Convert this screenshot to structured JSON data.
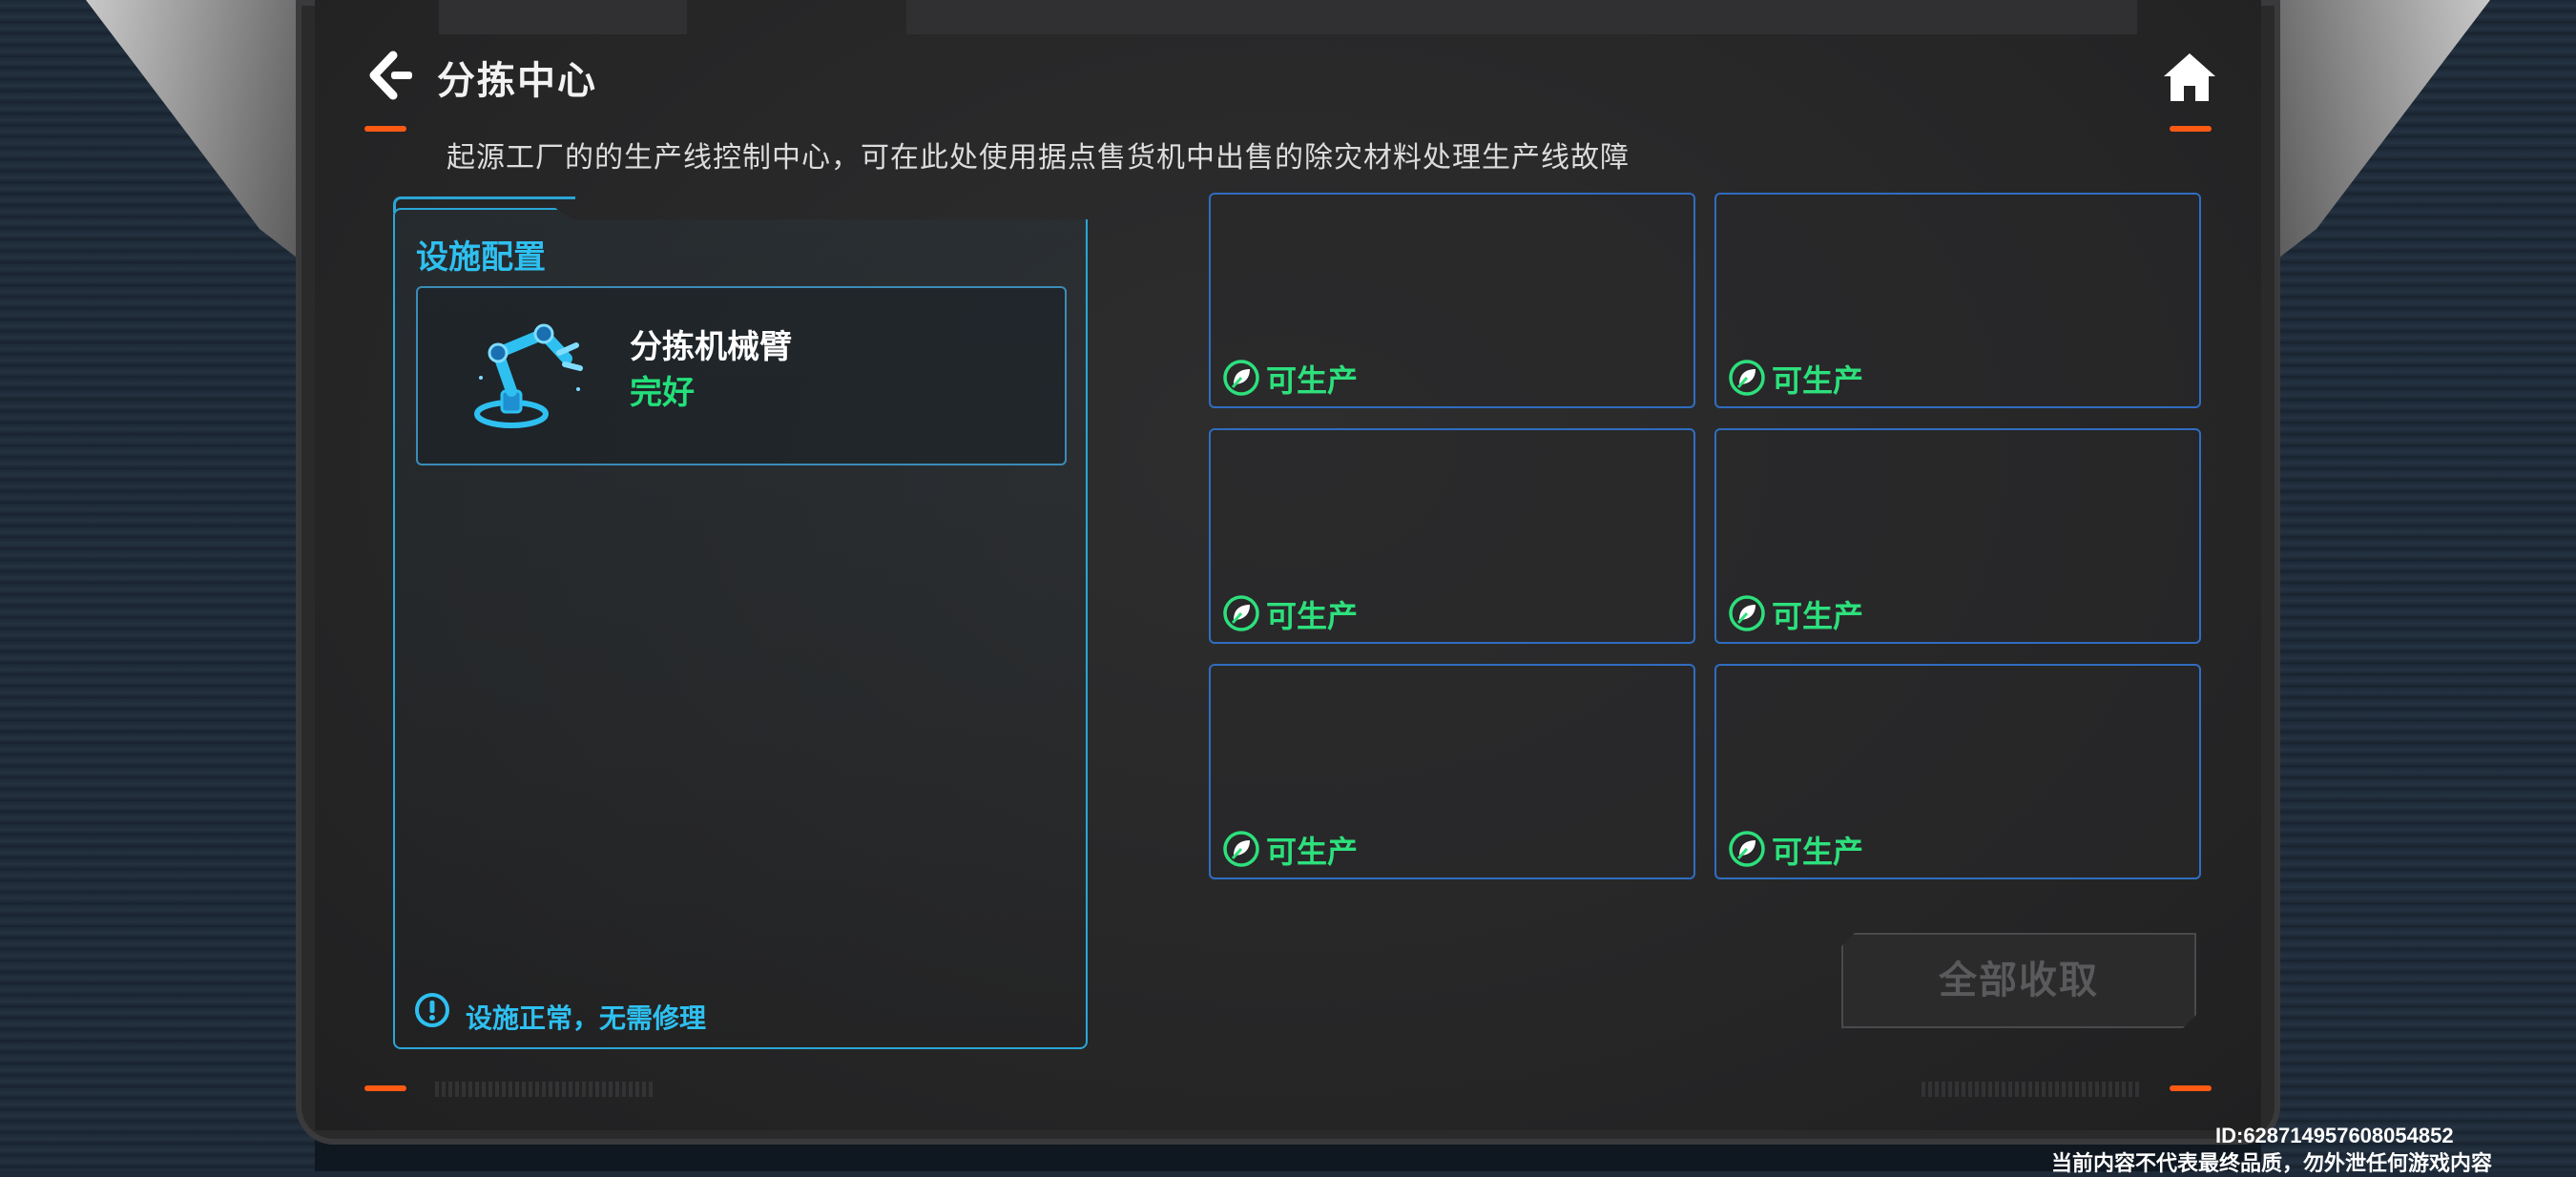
{
  "header": {
    "title": "分拣中心",
    "subtitle": "起源工厂的的生产线控制中心，可在此处使用据点售货机中出售的除灾材料处理生产线故障"
  },
  "facility": {
    "section_title": "设施配置",
    "name": "分拣机械臂",
    "status": "完好",
    "notice": "设施正常，无需修理"
  },
  "slots": [
    {
      "status": "可生产"
    },
    {
      "status": "可生产"
    },
    {
      "status": "可生产"
    },
    {
      "status": "可生产"
    },
    {
      "status": "可生产"
    },
    {
      "status": "可生产"
    }
  ],
  "actions": {
    "collect_all": "全部收取"
  },
  "watermark": {
    "id": "ID:628714957608054852",
    "note": "当前内容不代表最终品质，勿外泄任何游戏内容"
  },
  "icons": {
    "back": "back-arrow-icon",
    "home": "home-icon",
    "facility": "robot-arm-icon",
    "slot_status": "leaf-icon",
    "notice": "exclamation-circle-icon"
  },
  "colors": {
    "accent": "#ff5a14",
    "cyan": "#2ec0f0",
    "green": "#23e07a",
    "slot_border": "#2f6dc0"
  }
}
